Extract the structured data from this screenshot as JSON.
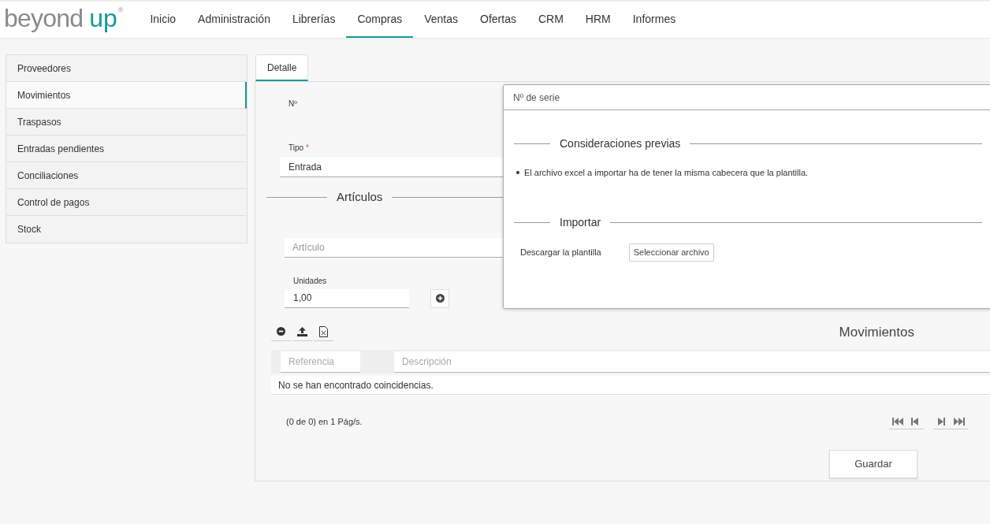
{
  "logo": {
    "word": "beyond",
    "accent": "up",
    "mark": "®"
  },
  "menu": [
    {
      "label": "Inicio",
      "selected": false
    },
    {
      "label": "Administración",
      "selected": false
    },
    {
      "label": "Librerías",
      "selected": false
    },
    {
      "label": "Compras",
      "selected": true
    },
    {
      "label": "Ventas",
      "selected": false
    },
    {
      "label": "Ofertas",
      "selected": false
    },
    {
      "label": "CRM",
      "selected": false
    },
    {
      "label": "HRM",
      "selected": false
    },
    {
      "label": "Informes",
      "selected": false
    }
  ],
  "sidebar": {
    "items": [
      {
        "label": "Proveedores",
        "selected": false
      },
      {
        "label": "Movimientos",
        "selected": true
      },
      {
        "label": "Traspasos",
        "selected": false
      },
      {
        "label": "Entradas pendientes",
        "selected": false
      },
      {
        "label": "Conciliaciones",
        "selected": false
      },
      {
        "label": "Control de pagos",
        "selected": false
      },
      {
        "label": "Stock",
        "selected": false
      }
    ]
  },
  "tabs": [
    {
      "label": "Detalle",
      "selected": true
    }
  ],
  "form": {
    "numero_label": "Nº",
    "tipo": {
      "label": "Tipo",
      "required_mark": "*",
      "value": "Entrada"
    },
    "section": "Artículos",
    "articulo": {
      "placeholder": "Artículo"
    },
    "unidades": {
      "label": "Unidades",
      "value": "1,00"
    }
  },
  "table": {
    "title": "Movimientos",
    "filters": [
      {
        "placeholder": "Referencia"
      },
      {
        "placeholder": "Descripción"
      }
    ],
    "empty_message": "No se han encontrado coincidencias.",
    "pager": "(0 de 0) en 1 Pág/s."
  },
  "save_button": "Guardar",
  "modal": {
    "title": "Nº de serie",
    "notes_heading": "Consideraciones previas",
    "notes": [
      "El archivo excel a importar ha de tener la misma cabecera que la plantilla."
    ],
    "import_heading": "Importar",
    "download_link": "Descargar la plantilla",
    "file_button": "Seleccionar archivo"
  }
}
